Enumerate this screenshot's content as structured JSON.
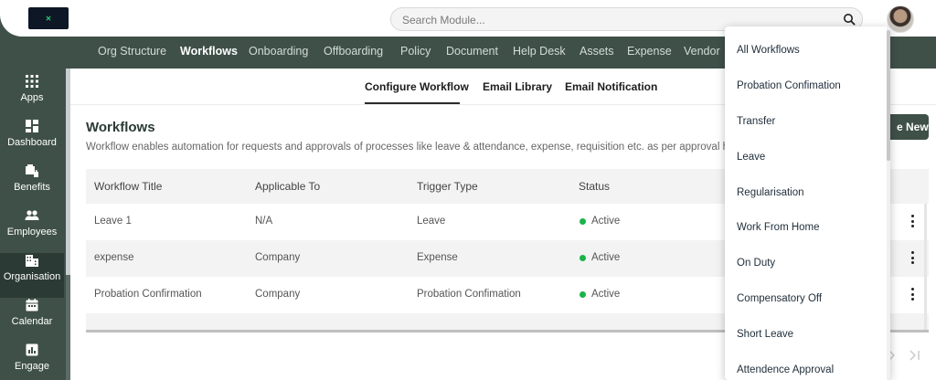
{
  "search": {
    "placeholder": "Search Module..."
  },
  "modules": [
    {
      "label": "Org Structure",
      "active": false
    },
    {
      "label": "Workflows",
      "active": true
    },
    {
      "label": "Onboarding",
      "active": false
    },
    {
      "label": "Offboarding",
      "active": false
    },
    {
      "label": "Policy",
      "active": false
    },
    {
      "label": "Document",
      "active": false
    },
    {
      "label": "Help Desk",
      "active": false
    },
    {
      "label": "Assets",
      "active": false
    },
    {
      "label": "Expense",
      "active": false
    },
    {
      "label": "Vendor",
      "active": false
    }
  ],
  "sidebar": {
    "items": [
      {
        "label": "Apps",
        "icon": "apps-grid-icon",
        "active": false
      },
      {
        "label": "Dashboard",
        "icon": "dashboard-icon",
        "active": false
      },
      {
        "label": "Benefits",
        "icon": "benefits-icon",
        "active": false
      },
      {
        "label": "Employees",
        "icon": "employees-icon",
        "active": false
      },
      {
        "label": "Organisation",
        "icon": "organisation-icon",
        "active": true
      },
      {
        "label": "Calendar",
        "icon": "calendar-icon",
        "active": false
      },
      {
        "label": "Engage",
        "icon": "engage-icon",
        "active": false
      }
    ]
  },
  "subtabs": [
    {
      "label": "Configure Workflow",
      "active": true
    },
    {
      "label": "Email Library",
      "active": false
    },
    {
      "label": "Email Notification",
      "active": false
    }
  ],
  "page": {
    "title": "Workflows",
    "description": "Workflow enables automation for requests and approvals of processes like leave & attendance, expense, requisition etc. as per approval hier",
    "create_button_label": "e New"
  },
  "table": {
    "headers": [
      "Workflow Title",
      "Applicable To",
      "Trigger Type",
      "Status"
    ],
    "rows": [
      {
        "title": "Leave 1",
        "applicable_to": "N/A",
        "trigger_type": "Leave",
        "status": "Active"
      },
      {
        "title": "expense",
        "applicable_to": "Company",
        "trigger_type": "Expense",
        "status": "Active"
      },
      {
        "title": "Probation Confirmation",
        "applicable_to": "Company",
        "trigger_type": "Probation Confimation",
        "status": "Active"
      }
    ]
  },
  "pager": {
    "next_icon": "chevron-right-icon",
    "last_icon": "last-page-icon"
  },
  "dropdown": {
    "items": [
      "All Workflows",
      "Probation Confimation",
      "Transfer",
      "Leave",
      "Regularisation",
      "Work From Home",
      "On Duty",
      "Compensatory Off",
      "Short Leave",
      "Attendence Approval"
    ]
  },
  "colors": {
    "brand": "#3f5049",
    "active_status": "#19b34a"
  }
}
